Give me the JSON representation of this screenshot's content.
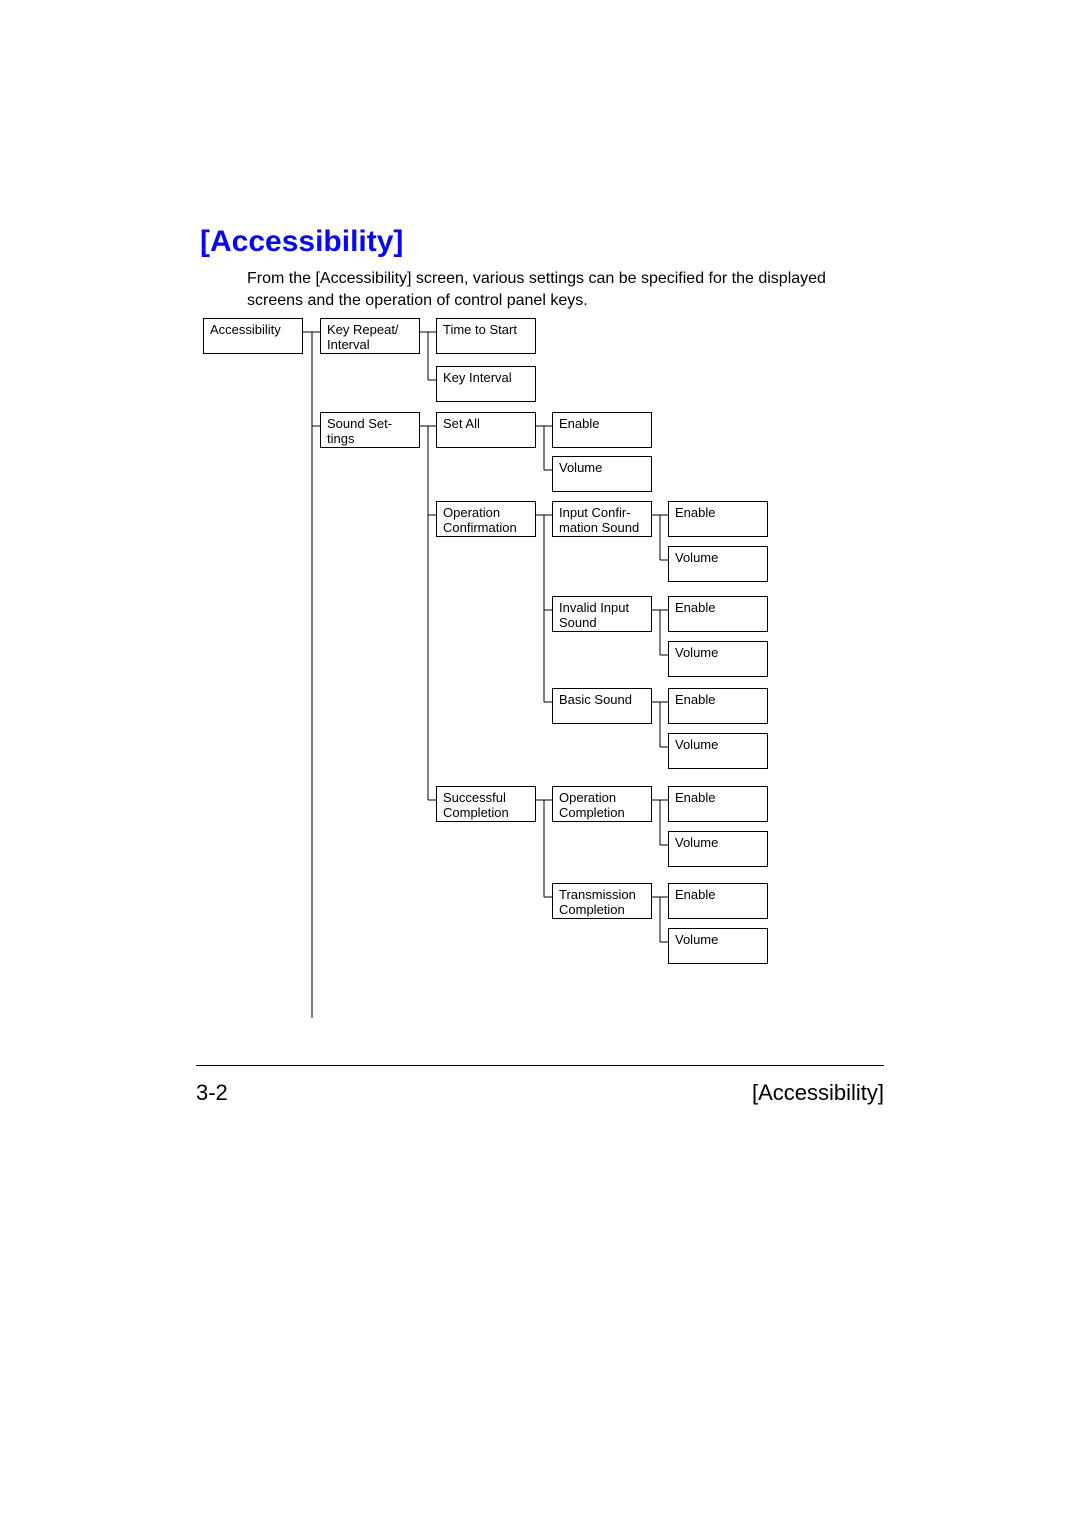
{
  "heading": "[Accessibility]",
  "intro": "From the [Accessibility] screen, various settings can be specified for the displayed screens and the operation of control panel keys.",
  "footer": {
    "page": "3-2",
    "title": "[Accessibility]"
  },
  "nodes": {
    "root": "Accessibility",
    "key_repeat": "Key Repeat/ Interval",
    "time_to_start": "Time to Start",
    "key_interval": "Key Interval",
    "sound_settings": "Sound Set­tings",
    "set_all": "Set All",
    "set_all_enable": "Enable",
    "set_all_volume": "Volume",
    "op_confirm": "Operation Confirmation",
    "input_confirm": "Input Confir­mation Sound",
    "input_confirm_enable": "Enable",
    "input_confirm_volume": "Volume",
    "invalid_input": "Invalid Input Sound",
    "invalid_input_enable": "Enable",
    "invalid_input_volume": "Volume",
    "basic_sound": "Basic Sound",
    "basic_sound_enable": "Enable",
    "basic_sound_volume": "Volume",
    "successful": "Successful Completion",
    "op_completion": "Operation Completion",
    "op_completion_enable": "Enable",
    "op_completion_volume": "Volume",
    "trans_completion": "Transmission Completion",
    "trans_completion_enable": "Enable",
    "trans_completion_volume": "Volume"
  }
}
